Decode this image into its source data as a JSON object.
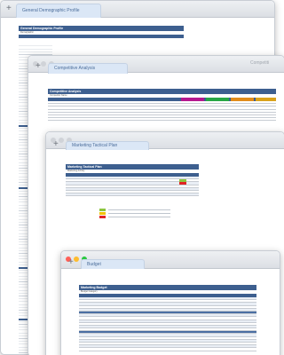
{
  "windows": {
    "demographic": {
      "tab_label": "General Demographic Profile",
      "sheet_title": "General Demographic Profile",
      "sheet_subtitle": "Demographic"
    },
    "competitive": {
      "tab_label": "Competitive Analysis",
      "ghost_tab": "Competiti",
      "sheet_title": "Competitive Analysis",
      "sheet_subtitle": "Competitor Name",
      "column_colors": [
        "#b5178e",
        "#27a745",
        "#e08c1b",
        "#d9a21b"
      ]
    },
    "tactical": {
      "tab_label": "Marketing Tactical Plan",
      "sheet_title": "Marketing Tactical Plan",
      "sheet_subtitle": "Marketing Activity",
      "legend_colors": [
        "#8cc63f",
        "#f2c200",
        "#e02424"
      ]
    },
    "budget": {
      "tab_label": "Budget",
      "sheet_title": "Marketing Budget",
      "sheet_subtitle": "Budget Category"
    }
  },
  "traffic_light_colors": [
    "#ff5f57",
    "#febc2e",
    "#28c840"
  ],
  "icons": {
    "new_tab": "+"
  }
}
